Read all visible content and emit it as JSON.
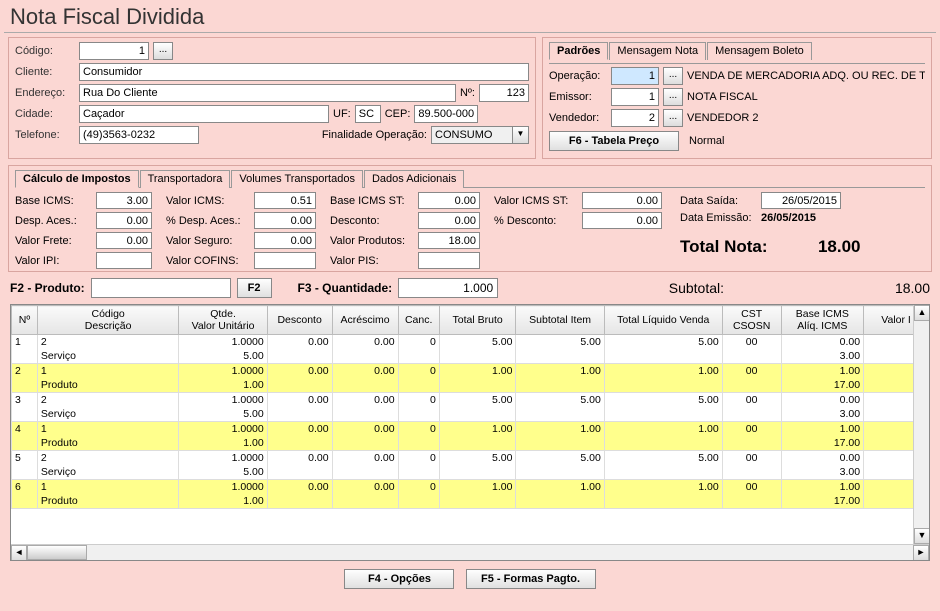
{
  "title": "Nota Fiscal Dividida",
  "left": {
    "codigo_label": "Código:",
    "codigo": "1",
    "cliente_label": "Cliente:",
    "cliente": "Consumidor",
    "endereco_label": "Endereço:",
    "endereco": "Rua Do Cliente",
    "num_label": "Nº:",
    "num": "123",
    "cidade_label": "Cidade:",
    "cidade": "Caçador",
    "uf_label": "UF:",
    "uf": "SC",
    "cep_label": "CEP:",
    "cep": "89.500-000",
    "telefone_label": "Telefone:",
    "telefone": "(49)3563-0232",
    "finalidade_label": "Finalidade Operação:",
    "finalidade": "CONSUMO"
  },
  "right": {
    "tabs": [
      "Padrões",
      "Mensagem Nota",
      "Mensagem Boleto"
    ],
    "operacao_label": "Operação:",
    "operacao": "1",
    "operacao_desc": "VENDA DE MERCADORIA ADQ. OU REC. DE TER",
    "emissor_label": "Emissor:",
    "emissor": "1",
    "emissor_desc": "NOTA FISCAL",
    "vendedor_label": "Vendedor:",
    "vendedor": "2",
    "vendedor_desc": "VENDEDOR 2",
    "f6_label": "F6 - Tabela Preço",
    "f6_desc": "Normal"
  },
  "calc": {
    "tabs": [
      "Cálculo de Impostos",
      "Transportadora",
      "Volumes Transportados",
      "Dados Adicionais"
    ],
    "base_icms_l": "Base ICMS:",
    "base_icms": "3.00",
    "desp_aces_l": "Desp. Aces.:",
    "desp_aces": "0.00",
    "valor_frete_l": "Valor Frete:",
    "valor_frete": "0.00",
    "valor_ipi_l": "Valor IPI:",
    "valor_ipi": "",
    "valor_icms_l": "Valor ICMS:",
    "valor_icms": "0.51",
    "pct_desp_l": "% Desp. Aces.:",
    "pct_desp": "0.00",
    "valor_seguro_l": "Valor Seguro:",
    "valor_seguro": "0.00",
    "valor_cofins_l": "Valor COFINS:",
    "valor_cofins": "",
    "base_icms_st_l": "Base ICMS ST:",
    "base_icms_st": "0.00",
    "desconto_l": "Desconto:",
    "desconto": "0.00",
    "valor_produtos_l": "Valor Produtos:",
    "valor_produtos": "18.00",
    "valor_pis_l": "Valor PIS:",
    "valor_pis": "",
    "valor_icms_st_l2": "Valor ICMS ST:",
    "valor_icms_st": "0.00",
    "pct_desconto_l": "% Desconto:",
    "pct_desconto": "0.00",
    "data_saida_l": "Data Saída:",
    "data_saida": "26/05/2015",
    "data_emissao_l": "Data Emissão:",
    "data_emissao": "26/05/2015",
    "total_label": "Total Nota:",
    "total": "18.00"
  },
  "entry": {
    "f2_label": "F2 - Produto:",
    "f2_btn": "F2",
    "f3_label": "F3 - Quantidade:",
    "f3_val": "1.000",
    "subtotal_label": "Subtotal:",
    "subtotal": "18.00"
  },
  "grid": {
    "headers": [
      "Nº",
      "Código\nDescrição",
      "Qtde.\nValor Unitário",
      "Desconto",
      "Acréscimo",
      "Canc.",
      "Total Bruto",
      "Subtotal Item",
      "Total Líquido Venda",
      "CST\nCSOSN",
      "Base ICMS\nAlíq. ICMS",
      "Valor I"
    ],
    "rows": [
      {
        "n": "1",
        "cod": "2",
        "desc": "Serviço",
        "qtd": "1.0000",
        "vu": "5.00",
        "desc2": "0.00",
        "acr": "0.00",
        "canc": "0",
        "tb": "5.00",
        "si": "5.00",
        "tlv": "5.00",
        "cst": "00",
        "bi": "0.00",
        "ai": "3.00",
        "hl": false
      },
      {
        "n": "2",
        "cod": "1",
        "desc": "Produto",
        "qtd": "1.0000",
        "vu": "1.00",
        "desc2": "0.00",
        "acr": "0.00",
        "canc": "0",
        "tb": "1.00",
        "si": "1.00",
        "tlv": "1.00",
        "cst": "00",
        "bi": "1.00",
        "ai": "17.00",
        "hl": true
      },
      {
        "n": "3",
        "cod": "2",
        "desc": "Serviço",
        "qtd": "1.0000",
        "vu": "5.00",
        "desc2": "0.00",
        "acr": "0.00",
        "canc": "0",
        "tb": "5.00",
        "si": "5.00",
        "tlv": "5.00",
        "cst": "00",
        "bi": "0.00",
        "ai": "3.00",
        "hl": false
      },
      {
        "n": "4",
        "cod": "1",
        "desc": "Produto",
        "qtd": "1.0000",
        "vu": "1.00",
        "desc2": "0.00",
        "acr": "0.00",
        "canc": "0",
        "tb": "1.00",
        "si": "1.00",
        "tlv": "1.00",
        "cst": "00",
        "bi": "1.00",
        "ai": "17.00",
        "hl": true
      },
      {
        "n": "5",
        "cod": "2",
        "desc": "Serviço",
        "qtd": "1.0000",
        "vu": "5.00",
        "desc2": "0.00",
        "acr": "0.00",
        "canc": "0",
        "tb": "5.00",
        "si": "5.00",
        "tlv": "5.00",
        "cst": "00",
        "bi": "0.00",
        "ai": "3.00",
        "hl": false
      },
      {
        "n": "6",
        "cod": "1",
        "desc": "Produto",
        "qtd": "1.0000",
        "vu": "1.00",
        "desc2": "0.00",
        "acr": "0.00",
        "canc": "0",
        "tb": "1.00",
        "si": "1.00",
        "tlv": "1.00",
        "cst": "00",
        "bi": "1.00",
        "ai": "17.00",
        "hl": true
      }
    ]
  },
  "footer": {
    "f4": "F4 - Opções",
    "f5": "F5 - Formas Pagto."
  }
}
